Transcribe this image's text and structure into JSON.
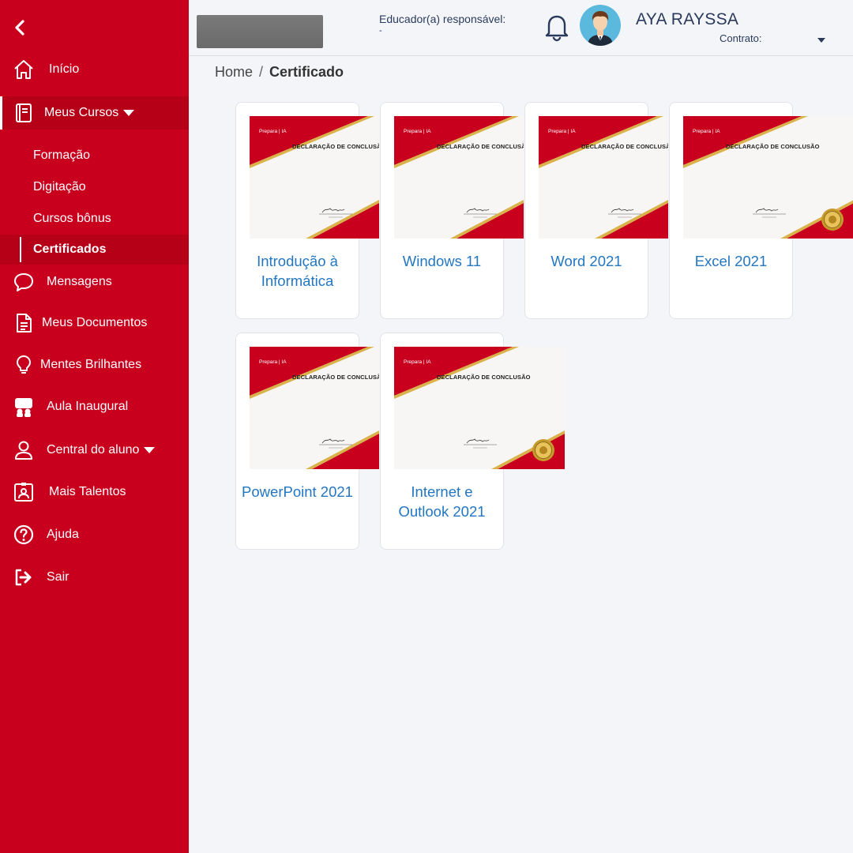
{
  "sidebar": {
    "items": [
      {
        "label": "Início",
        "icon": "home-icon"
      },
      {
        "label": "Meus Cursos",
        "icon": "book-icon"
      },
      {
        "label": "Mensagens",
        "icon": "chat-icon"
      },
      {
        "label": "Meus Documentos",
        "icon": "document-icon"
      },
      {
        "label": "Mentes Brilhantes",
        "icon": "lightbulb-icon"
      },
      {
        "label": "Aula Inaugural",
        "icon": "presentation-icon"
      },
      {
        "label": "Central do aluno",
        "icon": "user-icon"
      },
      {
        "label": "Mais Talentos",
        "icon": "id-badge-icon"
      },
      {
        "label": "Ajuda",
        "icon": "help-icon"
      },
      {
        "label": "Sair",
        "icon": "logout-icon"
      }
    ],
    "sub_items": [
      {
        "label": "Formação"
      },
      {
        "label": "Digitação"
      },
      {
        "label": "Cursos bônus"
      },
      {
        "label": "Certificados"
      }
    ]
  },
  "header": {
    "educator_label": "Educador(a) responsável:",
    "educator_value": "-",
    "user_name": "AYA RAYSSA",
    "contract_label": "Contrato:"
  },
  "breadcrumb": {
    "home": "Home",
    "separator": "/",
    "current": "Certificado"
  },
  "certificates": [
    {
      "title": "Introdução à Informática",
      "heading": "DECLARAÇÃO DE CONCLUSÃO",
      "seal": false
    },
    {
      "title": "Windows 11",
      "heading": "DECLARAÇÃO DE CONCLUSÃO",
      "seal": false
    },
    {
      "title": "Word 2021",
      "heading": "DECLARAÇÃO DE CONCLUSÃO",
      "seal": false
    },
    {
      "title": "Excel 2021",
      "heading": "DECLARAÇÃO DE CONCLUSÃO",
      "seal": true
    },
    {
      "title": "PowerPoint 2021",
      "heading": "DECLARAÇÃO DE CONCLUSÃO",
      "seal": false
    },
    {
      "title": "Internet e Outlook 2021",
      "heading": "DECLARAÇÃO DE CONCLUSÃO",
      "seal": true
    }
  ],
  "cert_brand": "Prepara | IA",
  "colors": {
    "sidebar": "#c8001e",
    "sidebar_active": "#b50018",
    "link": "#2276c2",
    "header_text": "#2a3a5c",
    "background": "#f4f5f9"
  }
}
